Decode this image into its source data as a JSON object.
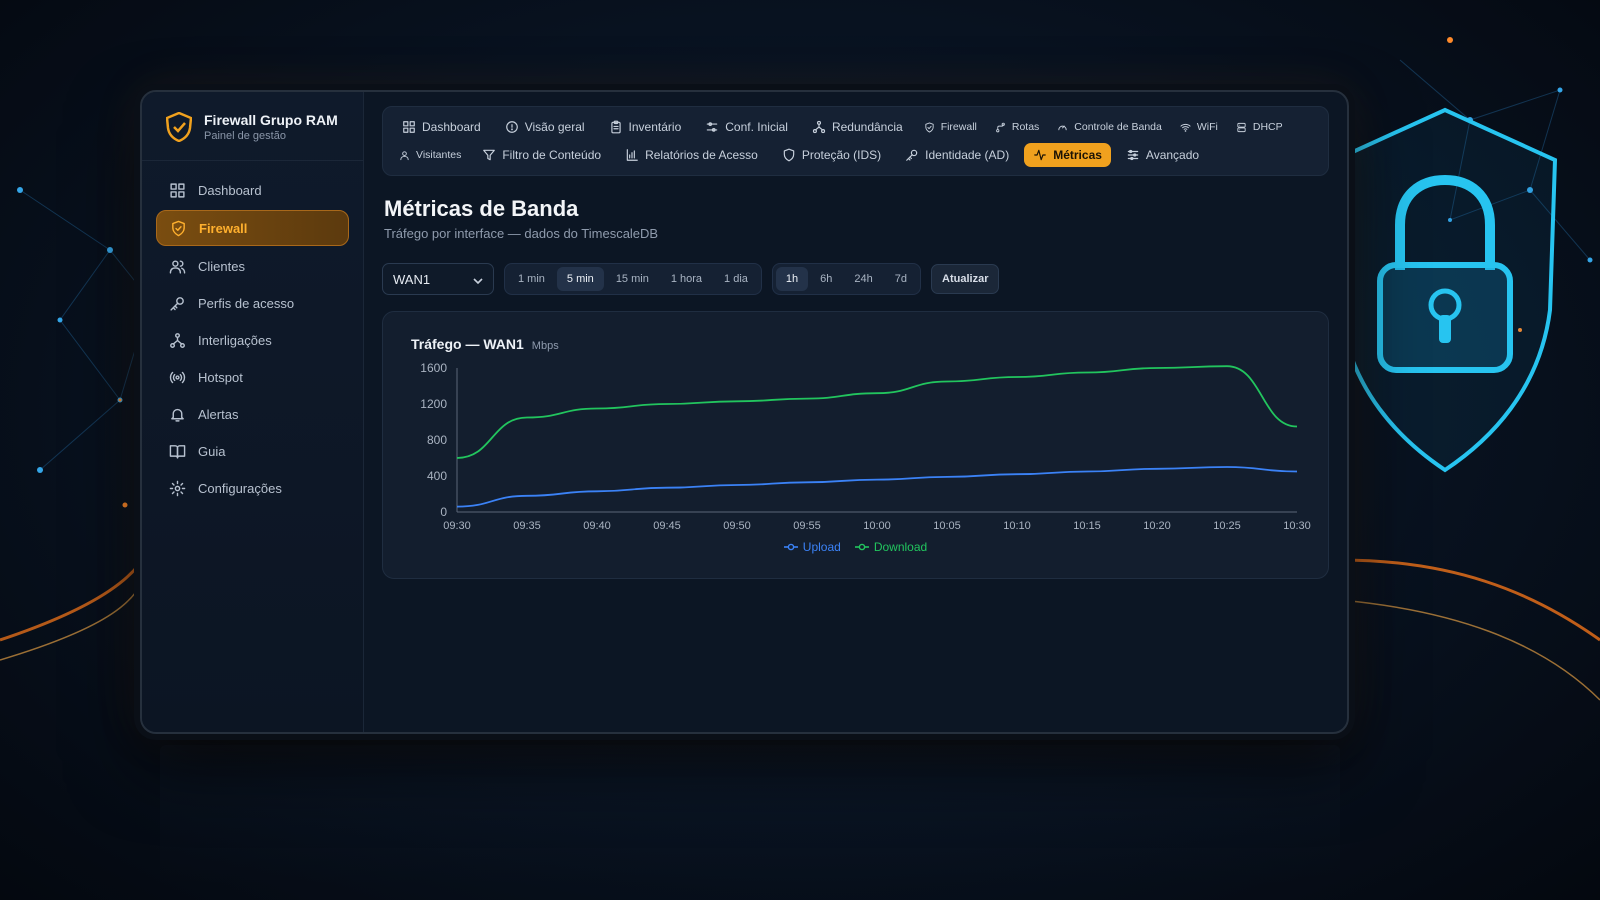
{
  "brand": {
    "title": "Firewall Grupo RAM",
    "subtitle": "Painel de gestão",
    "accent": "#f0a11e"
  },
  "sidebar": {
    "items": [
      {
        "label": "Dashboard",
        "icon": "grid-icon",
        "active": false
      },
      {
        "label": "Firewall",
        "icon": "shield-icon",
        "active": true
      },
      {
        "label": "Clientes",
        "icon": "users-icon",
        "active": false
      },
      {
        "label": "Perfis de acesso",
        "icon": "key-icon",
        "active": false
      },
      {
        "label": "Interligações",
        "icon": "network-icon",
        "active": false
      },
      {
        "label": "Hotspot",
        "icon": "broadcast-icon",
        "active": false
      },
      {
        "label": "Alertas",
        "icon": "bell-icon",
        "active": false
      },
      {
        "label": "Guia",
        "icon": "book-icon",
        "active": false
      },
      {
        "label": "Configurações",
        "icon": "gear-icon",
        "active": false
      }
    ]
  },
  "tabs": [
    {
      "label": "Dashboard",
      "icon": "grid-icon"
    },
    {
      "label": "Visão geral",
      "icon": "info-icon"
    },
    {
      "label": "Inventário",
      "icon": "clipboard-icon"
    },
    {
      "label": "Conf. Inicial",
      "icon": "sliders-icon"
    },
    {
      "label": "Redundância",
      "icon": "network-icon"
    },
    {
      "label": "Firewall",
      "icon": "shield-icon"
    },
    {
      "label": "Rotas",
      "icon": "route-icon"
    },
    {
      "label": "Controle de Banda",
      "icon": "gauge-icon"
    },
    {
      "label": "WiFi",
      "icon": "wifi-icon"
    },
    {
      "label": "DHCP",
      "icon": "server-icon"
    },
    {
      "label": "Visitantes",
      "icon": "user-icon"
    },
    {
      "label": "Filtro de Conteúdo",
      "icon": "filter-icon"
    },
    {
      "label": "Relatórios de Acesso",
      "icon": "bar-chart-icon"
    },
    {
      "label": "Proteção (IDS)",
      "icon": "shield-outline-icon"
    },
    {
      "label": "Identidade (AD)",
      "icon": "key-icon"
    },
    {
      "label": "Métricas",
      "icon": "activity-icon",
      "active": true
    },
    {
      "label": "Avançado",
      "icon": "settings-icon"
    }
  ],
  "page": {
    "title": "Métricas de Banda",
    "subtitle": "Tráfego por interface — dados do TimescaleDB"
  },
  "controls": {
    "interface": "WAN1",
    "intervals": [
      "1 min",
      "5 min",
      "15 min",
      "1 hora",
      "1 dia"
    ],
    "interval_selected": "5 min",
    "ranges": [
      "1h",
      "6h",
      "24h",
      "7d"
    ],
    "range_selected": "1h",
    "refresh_label": "Atualizar"
  },
  "chart_data": {
    "type": "line",
    "title": "Tráfego — WAN1",
    "unit": "Mbps",
    "x": [
      "09:30",
      "09:35",
      "09:40",
      "09:45",
      "09:50",
      "09:55",
      "10:00",
      "10:05",
      "10:10",
      "10:15",
      "10:20",
      "10:25",
      "10:30"
    ],
    "ylim": [
      0,
      1600
    ],
    "yticks": [
      0,
      400,
      800,
      1200,
      1600
    ],
    "series": [
      {
        "name": "Upload",
        "color": "#3b82f6",
        "values": [
          60,
          180,
          230,
          270,
          300,
          330,
          360,
          390,
          420,
          450,
          480,
          500,
          450
        ]
      },
      {
        "name": "Download",
        "color": "#22c55e",
        "values": [
          600,
          1050,
          1150,
          1200,
          1230,
          1260,
          1320,
          1450,
          1500,
          1550,
          1600,
          1620,
          950
        ]
      }
    ],
    "legend": "bottom-center",
    "grid": false
  }
}
